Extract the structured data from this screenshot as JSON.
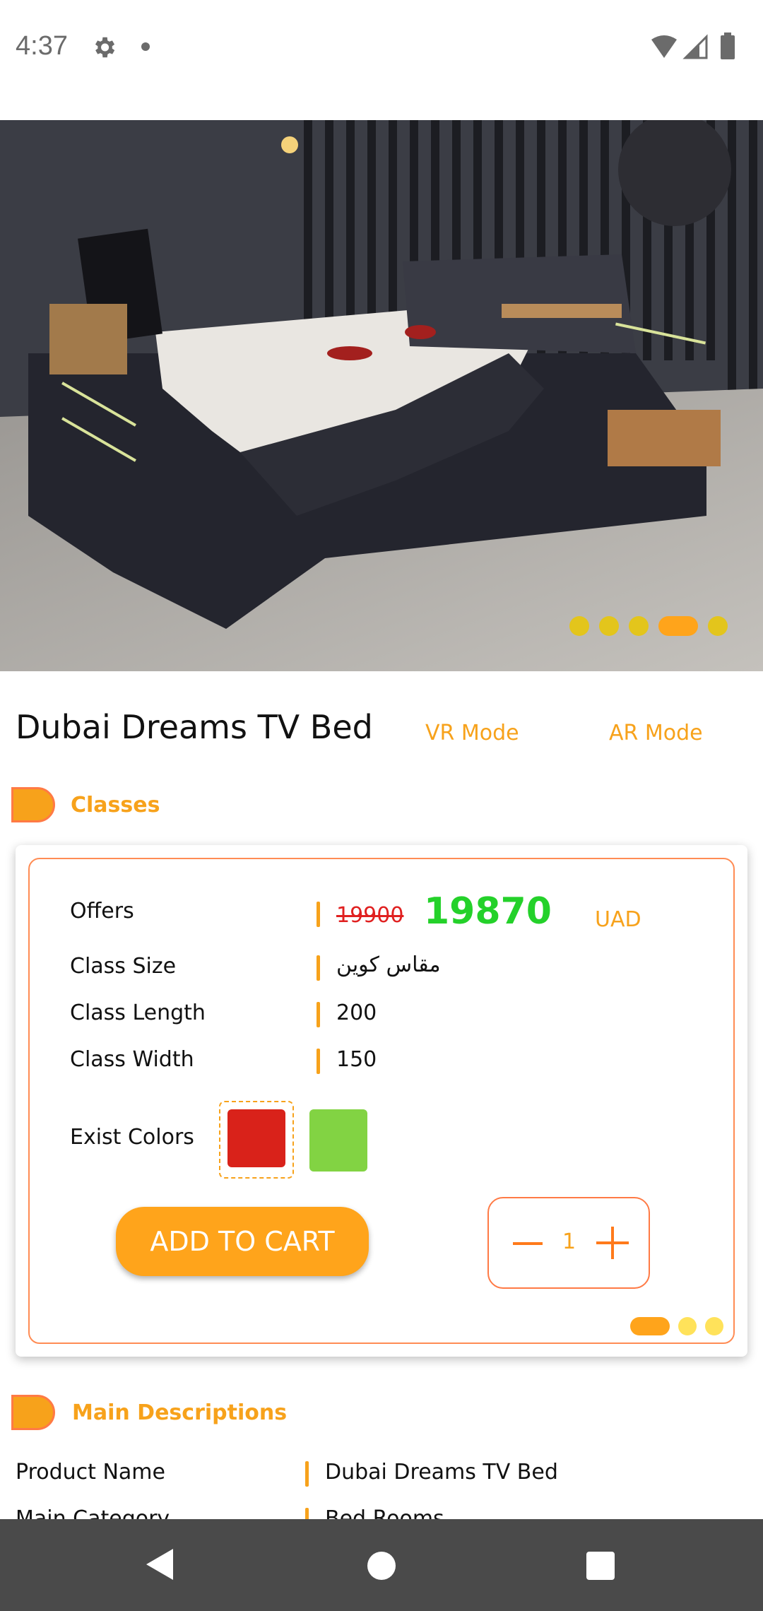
{
  "status_bar": {
    "time": "4:37"
  },
  "hero": {
    "image_slides": 5,
    "active_slide": 4
  },
  "product": {
    "title": "Dubai Dreams TV Bed",
    "vr_mode": "VR Mode",
    "ar_mode": "AR Mode"
  },
  "classes_section": {
    "title": "Classes",
    "rows": [
      {
        "label": "Offers",
        "old_price": "19900",
        "new_price": "19870",
        "currency": "UAD"
      },
      {
        "label": "Class Size",
        "value": "مقاس كوين"
      },
      {
        "label": "Class Length",
        "value": "200"
      },
      {
        "label": "Class Width",
        "value": "150"
      }
    ],
    "colors_label": "Exist Colors",
    "colors": [
      "#d9221a",
      "#82d343"
    ],
    "selected_color": 0,
    "add_to_cart": "ADD TO CART",
    "quantity": "1",
    "card_slides": 3,
    "active_card_slide": 1
  },
  "descriptions_section": {
    "title": "Main Descriptions",
    "rows": [
      {
        "label": "Product Name",
        "value": "Dubai Dreams TV Bed"
      },
      {
        "label": "Main Category",
        "value": "Bed Rooms"
      }
    ]
  }
}
